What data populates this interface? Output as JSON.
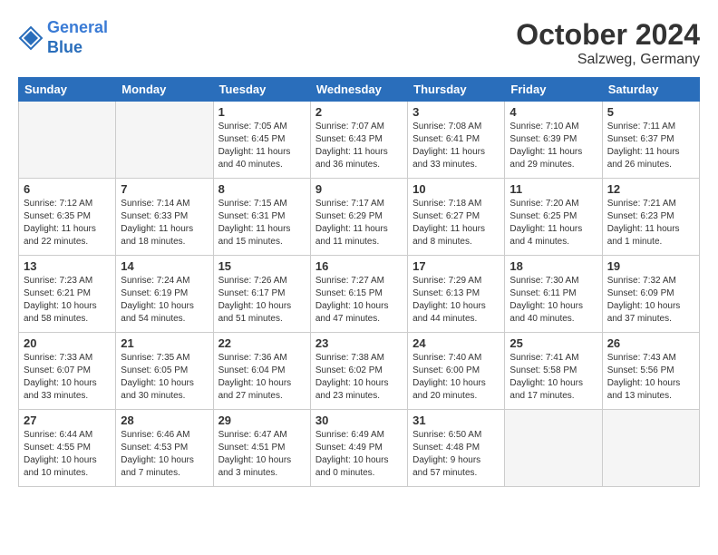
{
  "header": {
    "logo_line1": "General",
    "logo_line2": "Blue",
    "month_year": "October 2024",
    "location": "Salzweg, Germany"
  },
  "days_of_week": [
    "Sunday",
    "Monday",
    "Tuesday",
    "Wednesday",
    "Thursday",
    "Friday",
    "Saturday"
  ],
  "weeks": [
    [
      {
        "day": "",
        "info": ""
      },
      {
        "day": "",
        "info": ""
      },
      {
        "day": "1",
        "info": "Sunrise: 7:05 AM\nSunset: 6:45 PM\nDaylight: 11 hours\nand 40 minutes."
      },
      {
        "day": "2",
        "info": "Sunrise: 7:07 AM\nSunset: 6:43 PM\nDaylight: 11 hours\nand 36 minutes."
      },
      {
        "day": "3",
        "info": "Sunrise: 7:08 AM\nSunset: 6:41 PM\nDaylight: 11 hours\nand 33 minutes."
      },
      {
        "day": "4",
        "info": "Sunrise: 7:10 AM\nSunset: 6:39 PM\nDaylight: 11 hours\nand 29 minutes."
      },
      {
        "day": "5",
        "info": "Sunrise: 7:11 AM\nSunset: 6:37 PM\nDaylight: 11 hours\nand 26 minutes."
      }
    ],
    [
      {
        "day": "6",
        "info": "Sunrise: 7:12 AM\nSunset: 6:35 PM\nDaylight: 11 hours\nand 22 minutes."
      },
      {
        "day": "7",
        "info": "Sunrise: 7:14 AM\nSunset: 6:33 PM\nDaylight: 11 hours\nand 18 minutes."
      },
      {
        "day": "8",
        "info": "Sunrise: 7:15 AM\nSunset: 6:31 PM\nDaylight: 11 hours\nand 15 minutes."
      },
      {
        "day": "9",
        "info": "Sunrise: 7:17 AM\nSunset: 6:29 PM\nDaylight: 11 hours\nand 11 minutes."
      },
      {
        "day": "10",
        "info": "Sunrise: 7:18 AM\nSunset: 6:27 PM\nDaylight: 11 hours\nand 8 minutes."
      },
      {
        "day": "11",
        "info": "Sunrise: 7:20 AM\nSunset: 6:25 PM\nDaylight: 11 hours\nand 4 minutes."
      },
      {
        "day": "12",
        "info": "Sunrise: 7:21 AM\nSunset: 6:23 PM\nDaylight: 11 hours\nand 1 minute."
      }
    ],
    [
      {
        "day": "13",
        "info": "Sunrise: 7:23 AM\nSunset: 6:21 PM\nDaylight: 10 hours\nand 58 minutes."
      },
      {
        "day": "14",
        "info": "Sunrise: 7:24 AM\nSunset: 6:19 PM\nDaylight: 10 hours\nand 54 minutes."
      },
      {
        "day": "15",
        "info": "Sunrise: 7:26 AM\nSunset: 6:17 PM\nDaylight: 10 hours\nand 51 minutes."
      },
      {
        "day": "16",
        "info": "Sunrise: 7:27 AM\nSunset: 6:15 PM\nDaylight: 10 hours\nand 47 minutes."
      },
      {
        "day": "17",
        "info": "Sunrise: 7:29 AM\nSunset: 6:13 PM\nDaylight: 10 hours\nand 44 minutes."
      },
      {
        "day": "18",
        "info": "Sunrise: 7:30 AM\nSunset: 6:11 PM\nDaylight: 10 hours\nand 40 minutes."
      },
      {
        "day": "19",
        "info": "Sunrise: 7:32 AM\nSunset: 6:09 PM\nDaylight: 10 hours\nand 37 minutes."
      }
    ],
    [
      {
        "day": "20",
        "info": "Sunrise: 7:33 AM\nSunset: 6:07 PM\nDaylight: 10 hours\nand 33 minutes."
      },
      {
        "day": "21",
        "info": "Sunrise: 7:35 AM\nSunset: 6:05 PM\nDaylight: 10 hours\nand 30 minutes."
      },
      {
        "day": "22",
        "info": "Sunrise: 7:36 AM\nSunset: 6:04 PM\nDaylight: 10 hours\nand 27 minutes."
      },
      {
        "day": "23",
        "info": "Sunrise: 7:38 AM\nSunset: 6:02 PM\nDaylight: 10 hours\nand 23 minutes."
      },
      {
        "day": "24",
        "info": "Sunrise: 7:40 AM\nSunset: 6:00 PM\nDaylight: 10 hours\nand 20 minutes."
      },
      {
        "day": "25",
        "info": "Sunrise: 7:41 AM\nSunset: 5:58 PM\nDaylight: 10 hours\nand 17 minutes."
      },
      {
        "day": "26",
        "info": "Sunrise: 7:43 AM\nSunset: 5:56 PM\nDaylight: 10 hours\nand 13 minutes."
      }
    ],
    [
      {
        "day": "27",
        "info": "Sunrise: 6:44 AM\nSunset: 4:55 PM\nDaylight: 10 hours\nand 10 minutes."
      },
      {
        "day": "28",
        "info": "Sunrise: 6:46 AM\nSunset: 4:53 PM\nDaylight: 10 hours\nand 7 minutes."
      },
      {
        "day": "29",
        "info": "Sunrise: 6:47 AM\nSunset: 4:51 PM\nDaylight: 10 hours\nand 3 minutes."
      },
      {
        "day": "30",
        "info": "Sunrise: 6:49 AM\nSunset: 4:49 PM\nDaylight: 10 hours\nand 0 minutes."
      },
      {
        "day": "31",
        "info": "Sunrise: 6:50 AM\nSunset: 4:48 PM\nDaylight: 9 hours\nand 57 minutes."
      },
      {
        "day": "",
        "info": ""
      },
      {
        "day": "",
        "info": ""
      }
    ]
  ]
}
